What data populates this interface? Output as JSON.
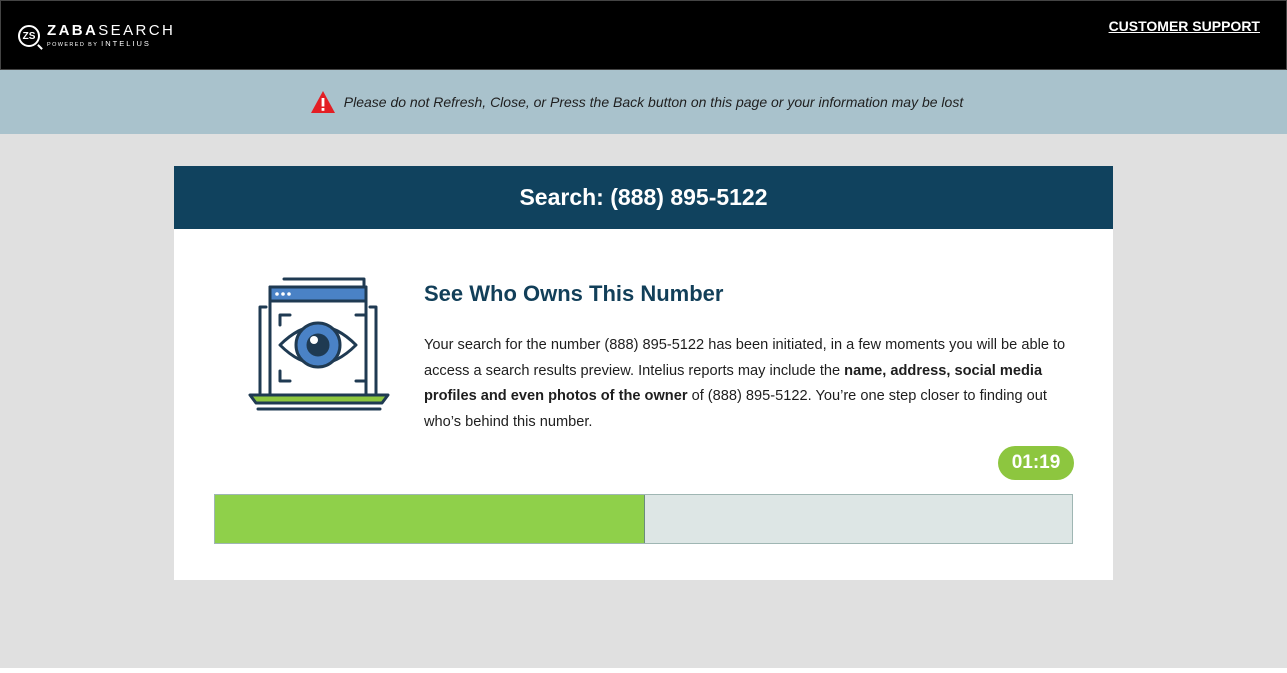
{
  "header": {
    "logo": {
      "badge": "ZS",
      "brand_bold": "ZABA",
      "brand_light": "SEARCH",
      "powered_by": "POWERED BY",
      "partner": "INTELIUS"
    },
    "support_link": "CUSTOMER SUPPORT"
  },
  "warning": {
    "icon": "warning-triangle-icon",
    "text": "Please do not Refresh, Close, or Press the Back button on this page or your information may be lost"
  },
  "card": {
    "title": "Search: (888) 895-5122",
    "heading": "See Who Owns This Number",
    "illustration": "laptop-eye-icon",
    "body": {
      "part1": "Your search for the number (888) 895-5122 has been initiated, in a few moments you will be able to access a search results preview. Intelius reports may include the ",
      "bold": "name, address, social media profiles and even photos of the owner",
      "part2": " of (888) 895-5122. You’re one step closer to finding out who’s behind this number."
    },
    "timer": "01:19",
    "progress_fraction": 0.5
  },
  "colors": {
    "header_bg": "#000000",
    "warning_bg": "#a9c2cc",
    "card_header_bg": "#10425e",
    "accent_green": "#8dc63f",
    "progress_track": "#dde6e5"
  }
}
